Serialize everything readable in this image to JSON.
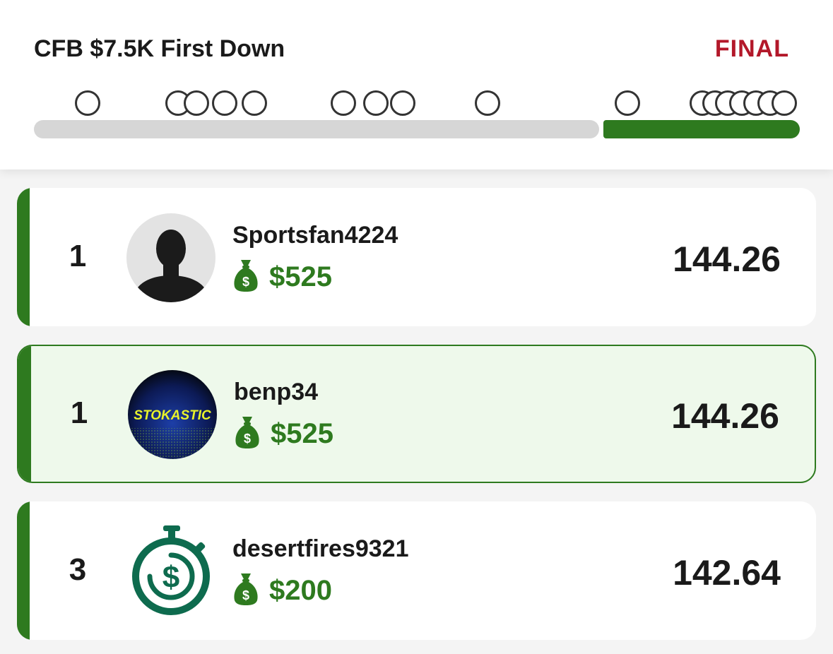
{
  "contest": {
    "title": "CFB $7.5K First Down",
    "status": "FINAL",
    "status_color": "#b3182a"
  },
  "progress": {
    "completed_fraction": 0.26,
    "colors": {
      "remaining": "#d6d6d6",
      "completed": "#2e7a1f"
    }
  },
  "entries": [
    {
      "rank": "1",
      "username": "Sportsfan4224",
      "prize": "$525",
      "score": "144.26",
      "avatar_icon": "default-person-avatar",
      "highlighted": false
    },
    {
      "rank": "1",
      "username": "benp34",
      "prize": "$525",
      "score": "144.26",
      "avatar_icon": "stokastic-logo-avatar",
      "avatar_text": "STOKASTIC",
      "highlighted": true
    },
    {
      "rank": "3",
      "username": "desertfires9321",
      "prize": "$200",
      "score": "142.64",
      "avatar_icon": "stopwatch-dollar-avatar",
      "highlighted": false
    }
  ],
  "icons": {
    "prize": "money-bag-icon"
  },
  "colors": {
    "accent": "#2e7a1f",
    "highlight_bg": "#eef9eb",
    "text": "#1a1a1a"
  }
}
